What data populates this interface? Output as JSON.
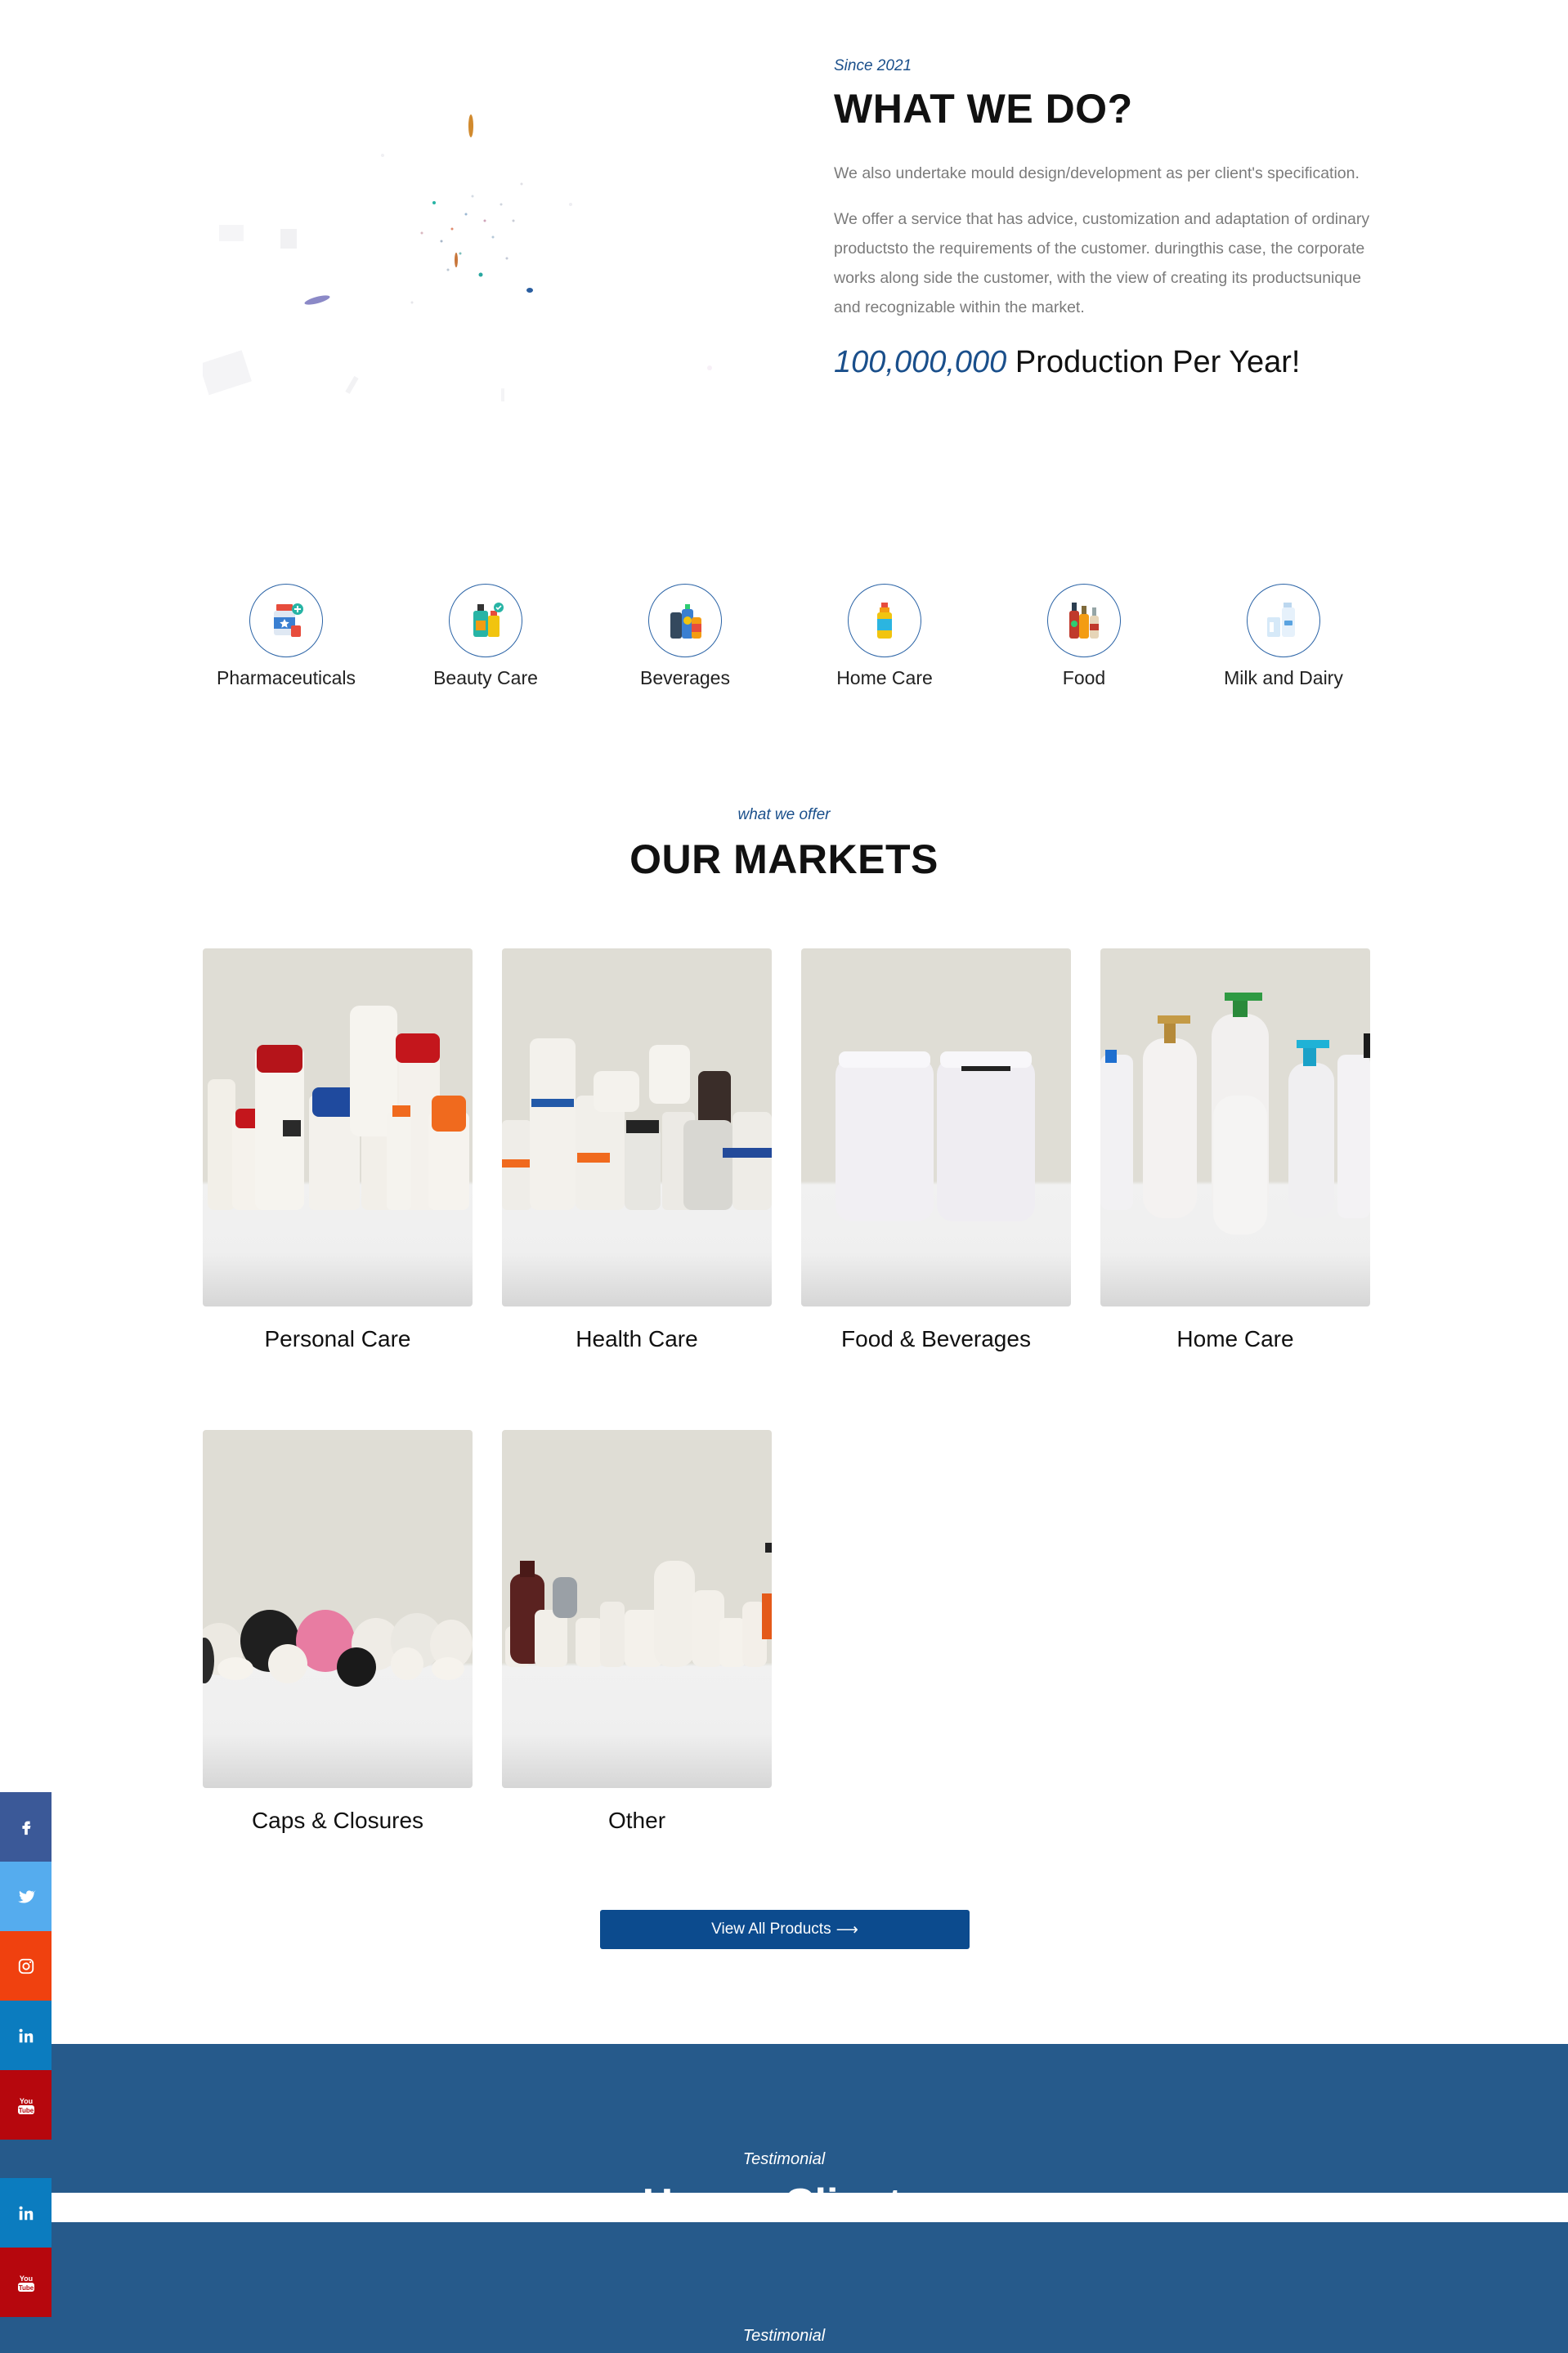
{
  "what_we_do": {
    "since": "Since 2021",
    "title": "WHAT WE DO?",
    "paragraph1": "We also undertake mould design/development as per client's specification.",
    "paragraph2": "We offer a service that has advice, customization and adaptation of ordinary productsto the requirements of the customer. duringthis case, the corporate works along side the customer, with the view of creating its productsunique and recognizable within the market.",
    "production_number": "100,000,000",
    "production_label": " Production Per Year!"
  },
  "categories": [
    {
      "label": "Pharmaceuticals",
      "icon": "pharmaceuticals-icon"
    },
    {
      "label": "Beauty Care",
      "icon": "beauty-care-icon"
    },
    {
      "label": "Beverages",
      "icon": "beverages-icon"
    },
    {
      "label": "Home Care",
      "icon": "home-care-icon"
    },
    {
      "label": "Food",
      "icon": "food-icon"
    },
    {
      "label": "Milk and Dairy",
      "icon": "milk-dairy-icon"
    }
  ],
  "markets": {
    "subtitle": "what we offer",
    "title": "OUR MARKETS",
    "items": [
      {
        "label": "Personal Care"
      },
      {
        "label": "Health Care"
      },
      {
        "label": "Food & Beverages"
      },
      {
        "label": "Home Care"
      },
      {
        "label": "Caps & Closures"
      },
      {
        "label": "Other"
      }
    ],
    "view_all_label": "View All Products",
    "view_all_arrow": "⟶"
  },
  "testimonial": {
    "subtitle": "Testimonial",
    "title": "Happy Clients"
  },
  "social": [
    {
      "name": "facebook",
      "icon": "facebook-icon",
      "color": "#3b5998"
    },
    {
      "name": "twitter",
      "icon": "twitter-icon",
      "color": "#55acee"
    },
    {
      "name": "instagram",
      "icon": "instagram-icon",
      "color": "#f0410f"
    },
    {
      "name": "linkedin",
      "icon": "linkedin-icon",
      "color": "#0b7cbf"
    },
    {
      "name": "youtube",
      "icon": "youtube-icon",
      "color": "#b6070d"
    }
  ],
  "colors": {
    "accent": "#1a4f8b",
    "button": "#0c4b8e",
    "band": "#265a8b"
  }
}
